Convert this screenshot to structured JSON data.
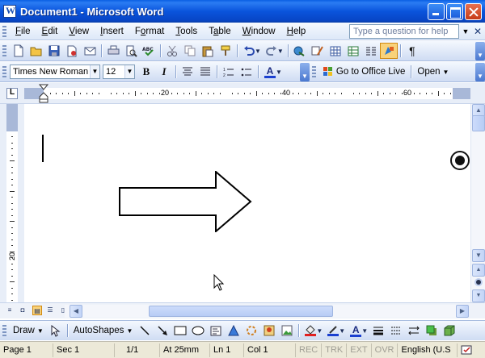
{
  "window": {
    "title": "Document1 - Microsoft Word"
  },
  "menu": {
    "items": [
      {
        "label": "File",
        "accel": "F"
      },
      {
        "label": "Edit",
        "accel": "E"
      },
      {
        "label": "View",
        "accel": "V"
      },
      {
        "label": "Insert",
        "accel": "I"
      },
      {
        "label": "Format",
        "accel": "o"
      },
      {
        "label": "Tools",
        "accel": "T"
      },
      {
        "label": "Table",
        "accel": "a"
      },
      {
        "label": "Window",
        "accel": "W"
      },
      {
        "label": "Help",
        "accel": "H"
      }
    ],
    "help_placeholder": "Type a question for help"
  },
  "formatting": {
    "font_name": "Times New Roman",
    "font_size": "12",
    "bold_label": "B",
    "italic_label": "I",
    "font_color_label": "A",
    "office_live_label": "Go to Office Live",
    "open_label": "Open"
  },
  "ruler": {
    "numbers": [
      "20",
      "40",
      "60"
    ],
    "vertical_number": "20"
  },
  "drawing": {
    "draw_label": "Draw",
    "autoshapes_label": "AutoShapes",
    "font_color_label": "A"
  },
  "status": {
    "page": "Page 1",
    "sec": "Sec 1",
    "pages": "1/1",
    "at": "At 25mm",
    "ln": "Ln 1",
    "col": "Col 1",
    "rec": "REC",
    "trk": "TRK",
    "ext": "EXT",
    "ovr": "OVR",
    "language": "English (U.S"
  },
  "colors": {
    "title_blue": "#0a54dc",
    "highlight_yellow": "#f9d27a",
    "font_color_red": "#e02020",
    "font_color_blue": "#1a3fd0"
  }
}
